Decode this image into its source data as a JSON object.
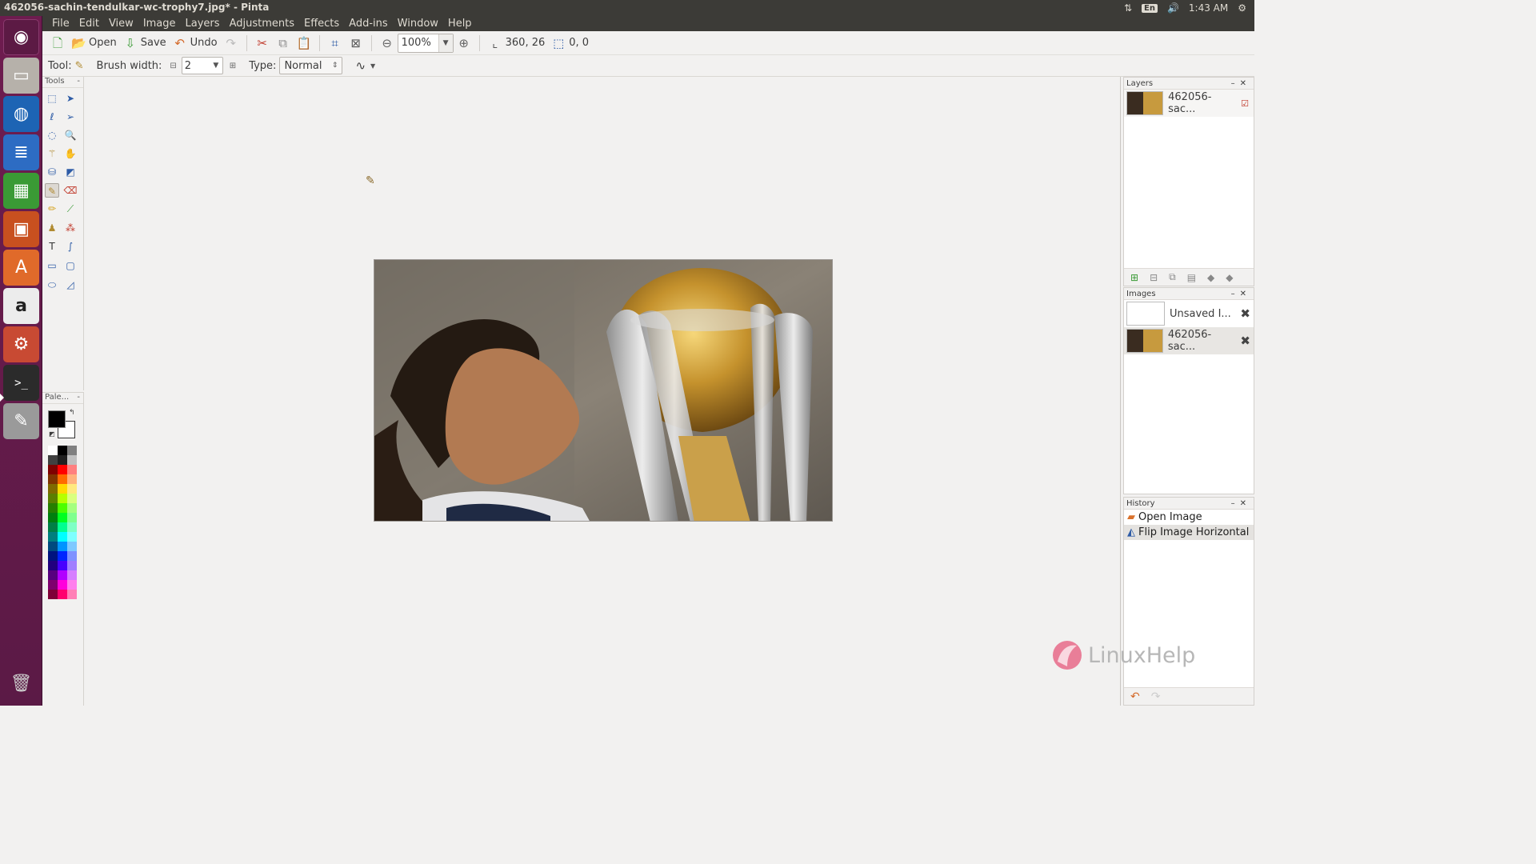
{
  "window": {
    "title": "462056-sachin-tendulkar-wc-trophy7.jpg* - Pinta"
  },
  "tray": {
    "sort_icon": "network-icon",
    "lang": "En",
    "volume_icon": "volume-icon",
    "time": "1:43 AM",
    "gear_icon": "settings-gear-icon"
  },
  "launcher": [
    {
      "name": "ubuntu-dash",
      "glyph": "◉",
      "bg": "#5c1a44"
    },
    {
      "name": "files",
      "glyph": "🗄",
      "bg": "#a8a39c"
    },
    {
      "name": "firefox",
      "glyph": "🦊",
      "bg": "#e66000"
    },
    {
      "name": "writer",
      "glyph": "📄",
      "bg": "#3771c8"
    },
    {
      "name": "calc",
      "glyph": "▦",
      "bg": "#3f9c35"
    },
    {
      "name": "impress",
      "glyph": "▣",
      "bg": "#d35400"
    },
    {
      "name": "software-center",
      "glyph": "A",
      "bg": "#e46b2c"
    },
    {
      "name": "amazon",
      "glyph": "a",
      "bg": "#e9e9e9"
    },
    {
      "name": "system-settings",
      "glyph": "⚙",
      "bg": "#7e8b96"
    },
    {
      "name": "terminal",
      "glyph": ">_",
      "bg": "#2c2c2c"
    },
    {
      "name": "pinta",
      "glyph": "✎",
      "bg": "#9a9a9a"
    }
  ],
  "launcher_trash": "trash",
  "menu": [
    "File",
    "Edit",
    "View",
    "Image",
    "Layers",
    "Adjustments",
    "Effects",
    "Add-ins",
    "Window",
    "Help"
  ],
  "toolbar": {
    "open": "Open",
    "save": "Save",
    "undo": "Undo",
    "zoom": "100%",
    "cursor_pos": "360, 26",
    "selection_size": "0, 0"
  },
  "options": {
    "tool_label": "Tool:",
    "brush_label": "Brush width:",
    "brush_width": "2",
    "type_label": "Type:",
    "type_value": "Normal"
  },
  "tools_panel": {
    "title": "Tools",
    "collapse": "-"
  },
  "palette_panel": {
    "title": "Pale...",
    "collapse": "-"
  },
  "layers_panel": {
    "title": "Layers",
    "layers": [
      {
        "name": "462056-sac...",
        "visible": true
      }
    ]
  },
  "images_panel": {
    "title": "Images",
    "images": [
      {
        "name": "Unsaved I..."
      },
      {
        "name": "462056-sac..."
      }
    ]
  },
  "history_panel": {
    "title": "History",
    "items": [
      {
        "label": "Open Image",
        "icon": "open-image-icon"
      },
      {
        "label": "Flip Image Horizontal",
        "icon": "flip-horizontal-icon"
      }
    ]
  },
  "panel_controls": {
    "minimize": "–",
    "close": "✕"
  },
  "watermark": {
    "text": "LinuxHelp"
  },
  "colors": {
    "primary": "#000000",
    "secondary": "#ffffff"
  }
}
